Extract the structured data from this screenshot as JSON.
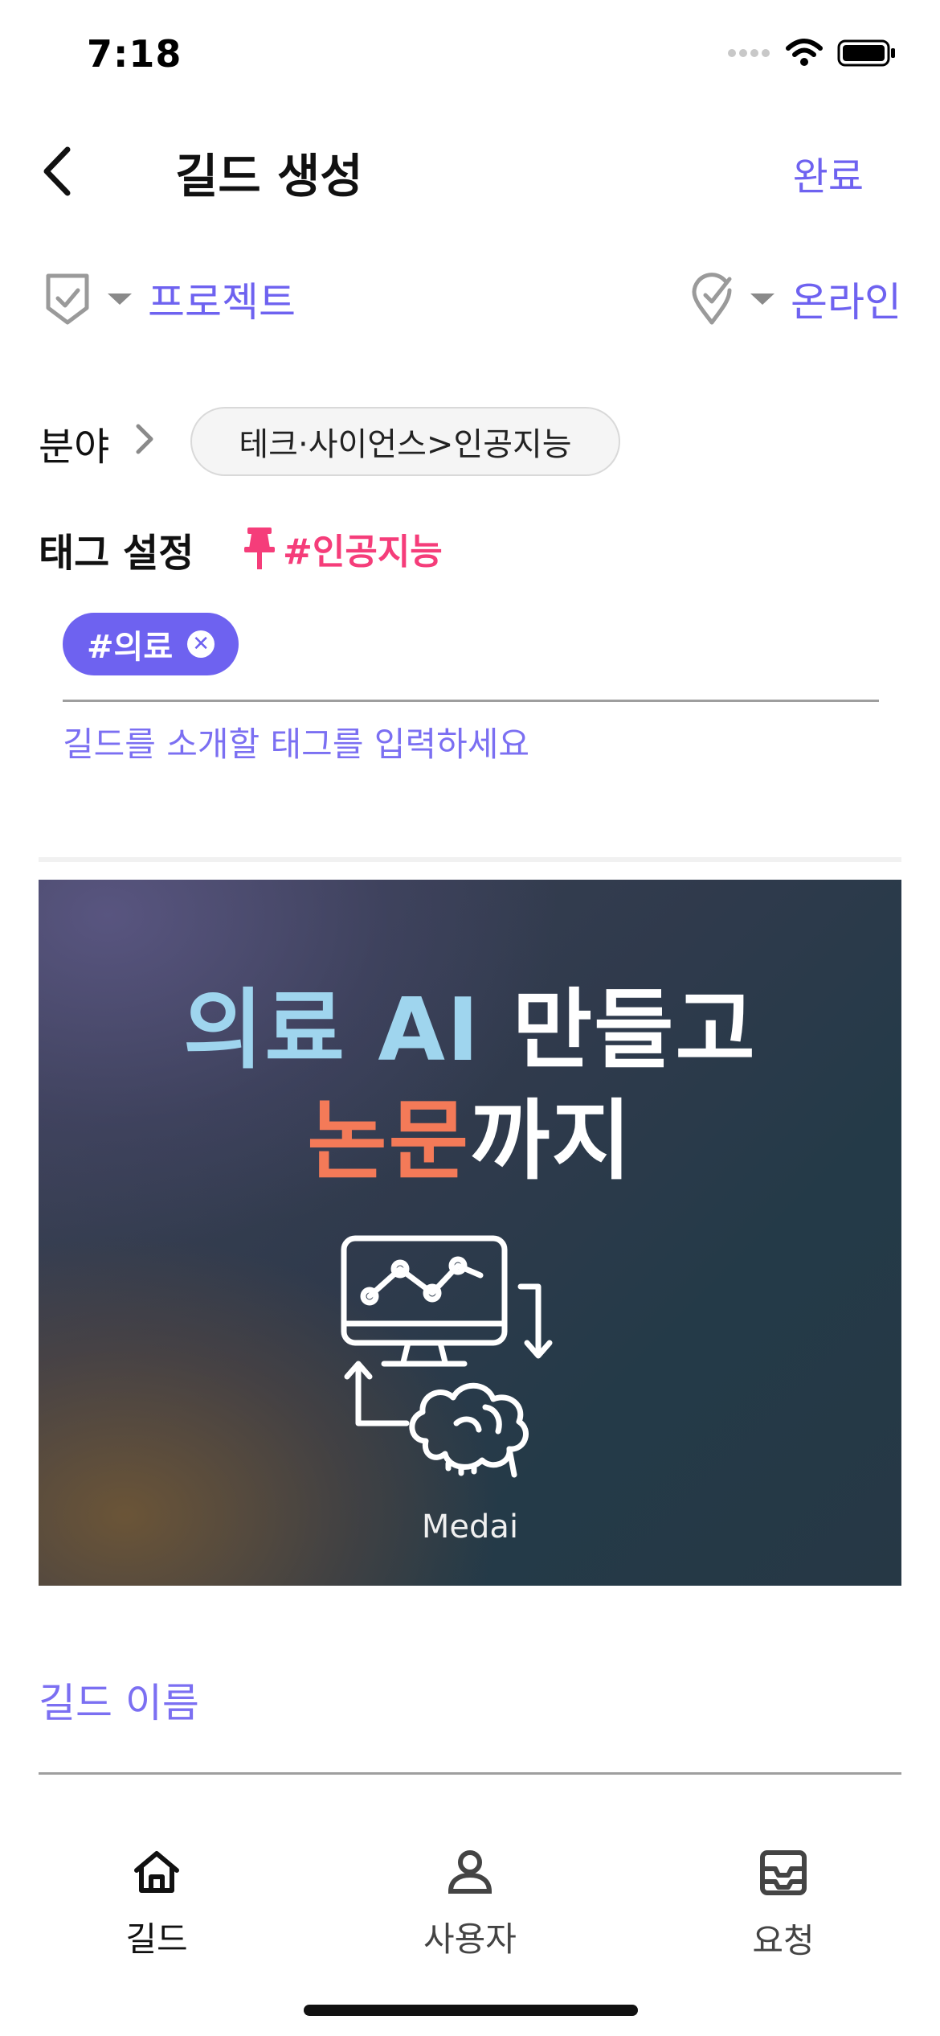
{
  "status_bar": {
    "time": "7:18"
  },
  "header": {
    "title": "길드 생성",
    "done_label": "완료"
  },
  "selectors": {
    "type": {
      "icon": "shield-check-icon",
      "label": "프로젝트"
    },
    "mode": {
      "icon": "location-check-icon",
      "label": "온라인"
    }
  },
  "field": {
    "label": "분야",
    "value": "테크·사이언스>인공지능"
  },
  "tags": {
    "label": "태그 설정",
    "pinned": "#인공지능",
    "chips": [
      "#의료"
    ],
    "placeholder": "길드를 소개할 태그를 입력하세요"
  },
  "banner": {
    "line1_highlight": "의료 AI",
    "line1_rest": " 만들고",
    "line2_highlight": "논문",
    "line2_rest": "까지",
    "brand": "Medai"
  },
  "name_field": {
    "placeholder": "길드 이름"
  },
  "tab_bar": {
    "items": [
      {
        "label": "길드",
        "icon": "home-icon",
        "active": true
      },
      {
        "label": "사용자",
        "icon": "user-icon",
        "active": false
      },
      {
        "label": "요청",
        "icon": "inbox-icon",
        "active": false
      }
    ]
  },
  "colors": {
    "accent": "#6e62f0",
    "pin": "#f53d7a"
  }
}
